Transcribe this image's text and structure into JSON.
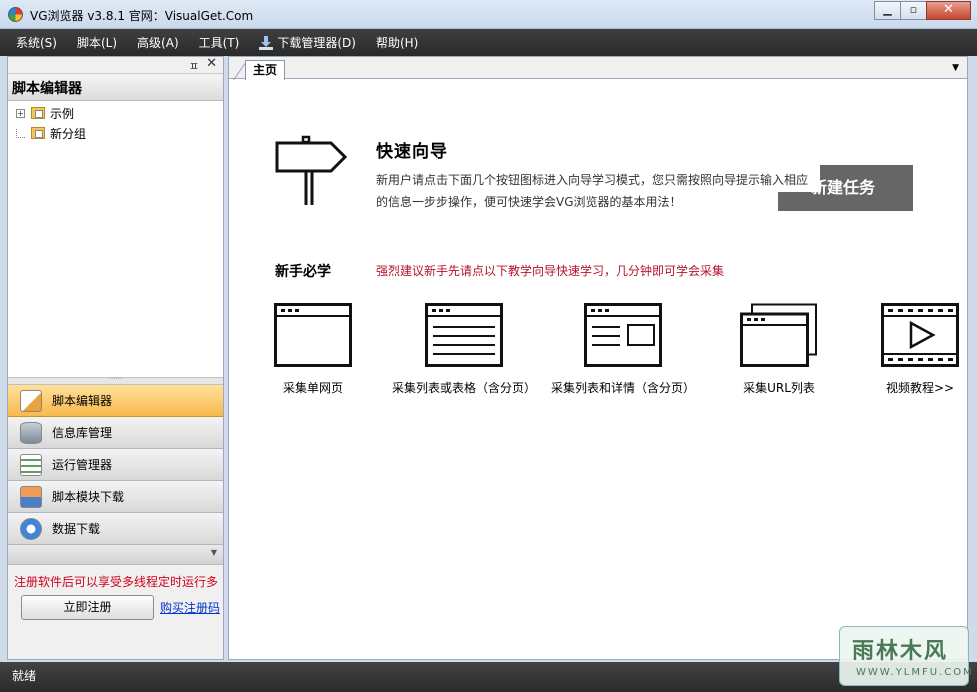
{
  "window": {
    "title": "VG浏览器 v3.8.1 官网：VisualGet.Com",
    "min_glyph": "▁",
    "max_glyph": "▫",
    "close_glyph": "✕"
  },
  "menu": [
    {
      "label": "系统(S)"
    },
    {
      "label": "脚本(L)"
    },
    {
      "label": "高级(A)"
    },
    {
      "label": "工具(T)"
    },
    {
      "label": "下载管理器(D)",
      "icon": "download-icon"
    },
    {
      "label": "帮助(H)"
    }
  ],
  "left_panel": {
    "pin_glyph": "ㅍ",
    "close_glyph": "✕",
    "header": "脚本编辑器",
    "tree": [
      {
        "label": "示例",
        "expandable": true
      },
      {
        "label": "新分组",
        "expandable": false
      }
    ],
    "nav": [
      {
        "label": "脚本编辑器",
        "active": true,
        "icon": "script-editor-icon"
      },
      {
        "label": "信息库管理",
        "active": false,
        "icon": "database-icon"
      },
      {
        "label": "运行管理器",
        "active": false,
        "icon": "run-manager-icon"
      },
      {
        "label": "脚本模块下载",
        "active": false,
        "icon": "module-download-icon"
      },
      {
        "label": "数据下载",
        "active": false,
        "icon": "data-download-icon"
      }
    ],
    "register_note": "注册软件后可以享受多线程定时运行多",
    "register_button": "立即注册",
    "buy_link": "购买注册码"
  },
  "right_panel": {
    "tab_label": "主页",
    "wizard": {
      "title": "快速向导",
      "desc_line1": "新用户请点击下面几个按钮图标进入向导学习模式，您只需按照向导提示输入相应",
      "desc_line2": "的信息一步步操作，便可快速学会VG浏览器的基本用法！",
      "create_label": "新建任务"
    },
    "learn": {
      "title": "新手必学",
      "note": "强烈建议新手先请点以下教学向导快速学习，几分钟即可学会采集"
    },
    "cards": [
      {
        "label": "采集单网页",
        "icon": "single-page-icon"
      },
      {
        "label": "采集列表或表格（含分页）",
        "icon": "list-table-icon"
      },
      {
        "label": "采集列表和详情（含分页）",
        "icon": "list-detail-icon"
      },
      {
        "label": "采集URL列表",
        "icon": "url-list-icon"
      },
      {
        "label": "视频教程>>",
        "icon": "video-tutorial-icon"
      }
    ]
  },
  "status": {
    "text": "就绪"
  },
  "watermark": {
    "big": "雨林木风",
    "small": "WWW.YLMFU.COM"
  },
  "colors": {
    "menubar": "#333333",
    "active_nav": "#f8b94c",
    "note_red": "#b5122c"
  }
}
